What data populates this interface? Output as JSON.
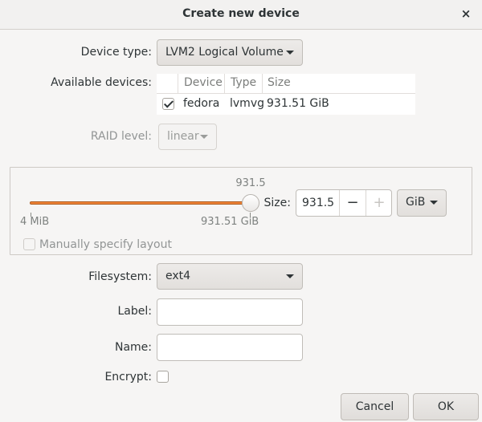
{
  "window": {
    "title": "Create new device",
    "close_glyph": "×"
  },
  "device_type": {
    "label": "Device type:",
    "value": "LVM2 Logical Volume"
  },
  "available_devices": {
    "label": "Available devices:",
    "columns": [
      "Device",
      "Type",
      "Size"
    ],
    "rows": [
      {
        "checked": true,
        "device": "fedora",
        "type": "lvmvg",
        "size": "931.51 GiB"
      }
    ]
  },
  "raid": {
    "label": "RAID level:",
    "value": "linear"
  },
  "size": {
    "current_label": "931.5",
    "min_label": "4 MiB",
    "max_label": "931.51 GiB",
    "fraction": 1.0,
    "label": "Size:",
    "value": "931.5",
    "minus": "−",
    "plus": "+",
    "unit": "GiB"
  },
  "manual_layout": {
    "label": "Manually specify layout",
    "checked": false
  },
  "filesystem": {
    "label": "Filesystem:",
    "value": "ext4"
  },
  "label_field": {
    "label": "Label:",
    "value": ""
  },
  "name_field": {
    "label": "Name:",
    "value": ""
  },
  "encrypt": {
    "label": "Encrypt:",
    "checked": false
  },
  "buttons": {
    "cancel": "Cancel",
    "ok": "OK"
  },
  "colors": {
    "accent": "#f08437",
    "background": "#f6f5f4"
  }
}
